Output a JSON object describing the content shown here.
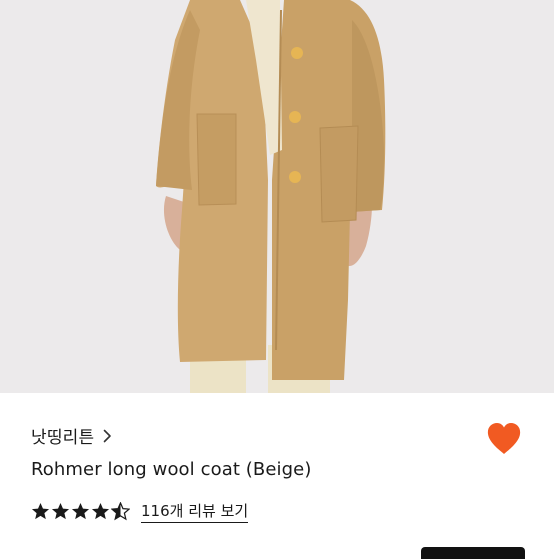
{
  "product": {
    "brand": "낫띵리튼",
    "title": "Rohmer long wool coat (Beige)",
    "rating": 4.5,
    "rating_max": 5,
    "review_link": "116개 리뷰 보기",
    "wishlisted": true
  },
  "colors": {
    "accent": "#f15a22",
    "coat": "#cfa870",
    "background": "#eceaeb"
  },
  "icons": {
    "brand_chevron": "chevron-right-icon",
    "wishlist": "heart-icon",
    "rating": "star-icon"
  }
}
